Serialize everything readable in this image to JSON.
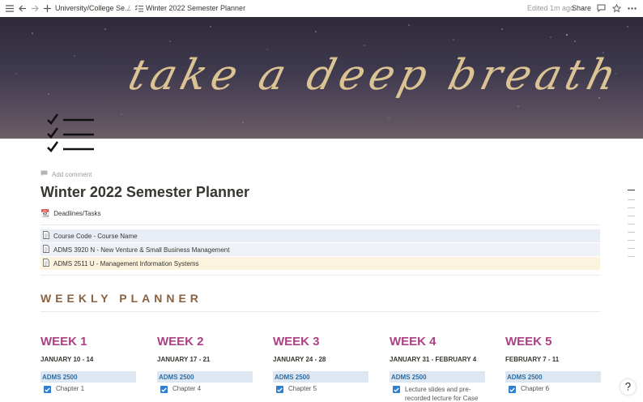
{
  "breadcrumb": {
    "parent": "University/College Se...",
    "separator": "/",
    "current": "Winter 2022 Semester Planner"
  },
  "topbar": {
    "edited": "Edited 1m ago",
    "share": "Share"
  },
  "cover": {
    "text": "take a deep breath"
  },
  "page": {
    "add_comment": "Add comment",
    "title": "Winter 2022 Semester Planner"
  },
  "deadlines": {
    "icon": "📆",
    "label": "Deadlines/Tasks"
  },
  "courses": [
    {
      "label": "Course Code - Course Name",
      "color": "#e7ecf5"
    },
    {
      "label": "ADMS 3920 N - New Venture & Small Business Management",
      "color": "#eef1f7"
    },
    {
      "label": "ADMS 2511 U - Management Information Systems",
      "color": "#fbf3de"
    }
  ],
  "weekly_heading": "WEEKLY PLANNER",
  "weeks": [
    {
      "title": "WEEK 1",
      "dates": "JANUARY 10 - 14",
      "course": "ADMS 2500",
      "task": "Chapter 1"
    },
    {
      "title": "WEEK 2",
      "dates": "JANUARY 17 - 21",
      "course": "ADMS 2500",
      "task": "Chapter 4"
    },
    {
      "title": "WEEK 3",
      "dates": "JANUARY 24 - 28",
      "course": "ADMS 2500",
      "task": "Chapter 5"
    },
    {
      "title": "WEEK 4",
      "dates": "JANUARY 31 - FEBRUARY 4",
      "course": "ADMS 2500",
      "task": "Lecture slides and pre-recorded lecture for Case"
    },
    {
      "title": "WEEK 5",
      "dates": "FEBRUARY 7 - 11",
      "course": "ADMS 2500",
      "task": "Chapter 6"
    }
  ],
  "colors": {
    "accent": "#ad3f83",
    "heading": "#8a6240",
    "checkbox": "#2f7fd0"
  }
}
